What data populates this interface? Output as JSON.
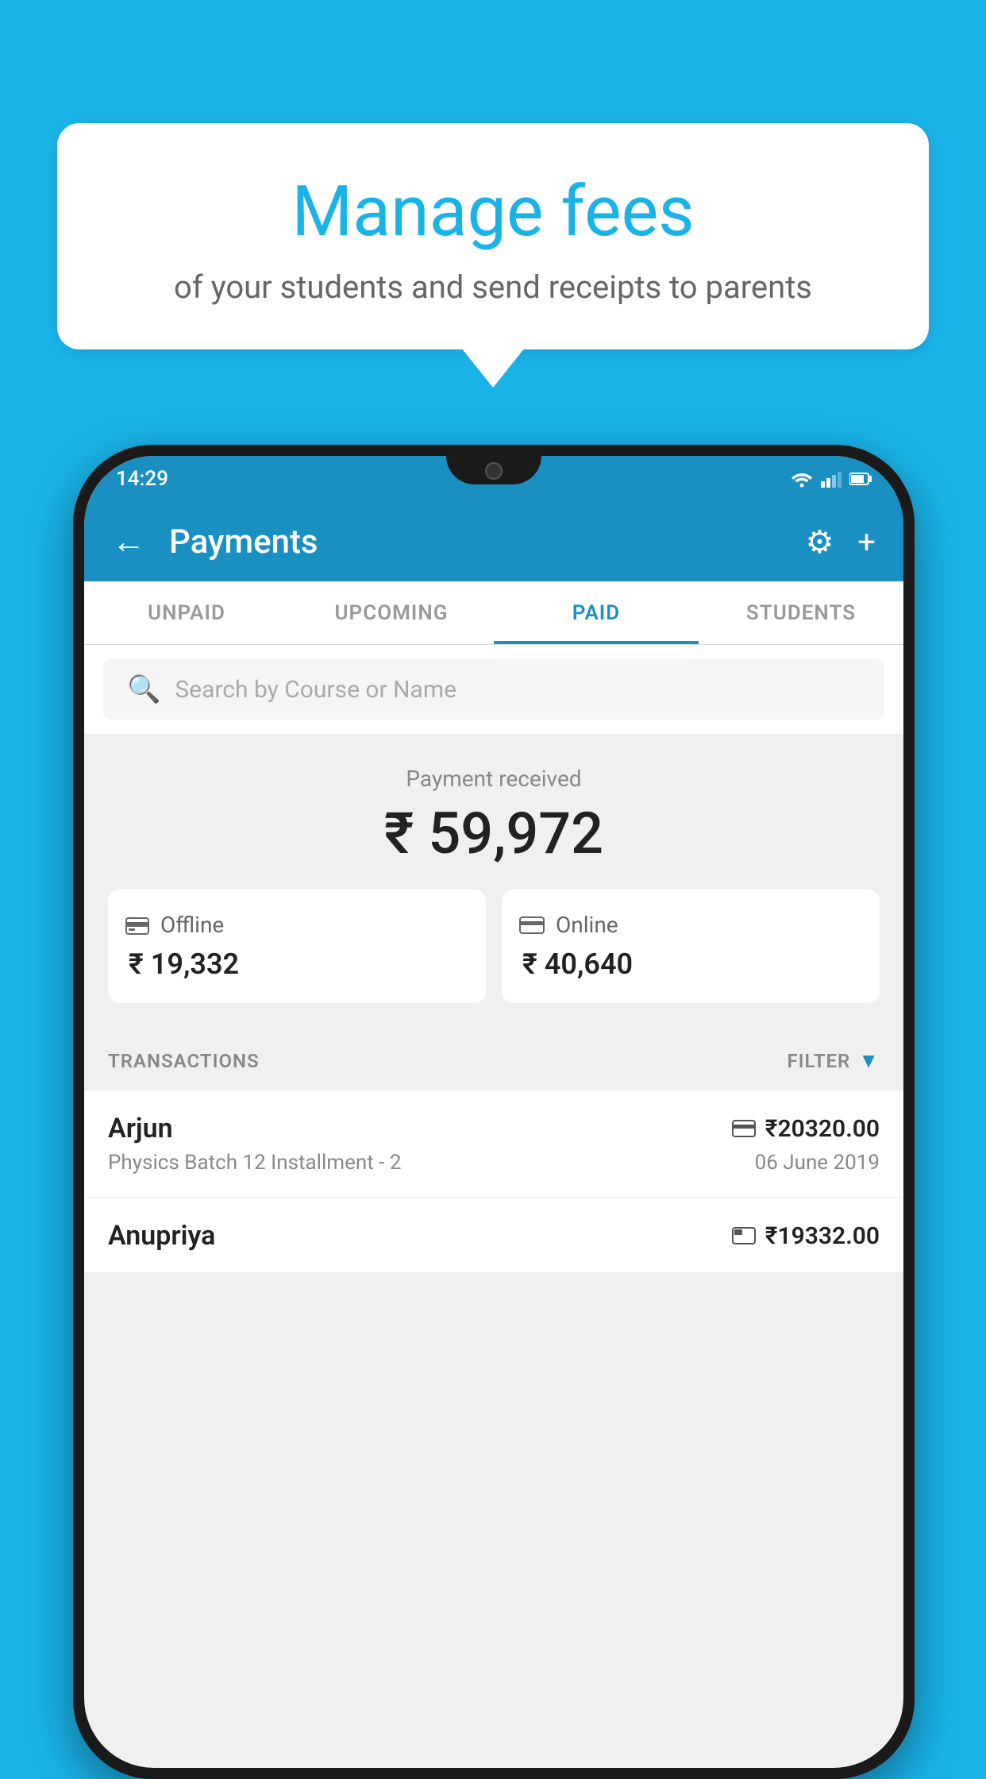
{
  "background_color": "#1ab3e8",
  "bubble": {
    "title": "Manage fees",
    "subtitle": "of your students and send receipts to parents"
  },
  "status_bar": {
    "time": "14:29"
  },
  "app_bar": {
    "title": "Payments",
    "back_label": "←",
    "gear_label": "⚙",
    "plus_label": "+"
  },
  "tabs": [
    {
      "label": "UNPAID",
      "active": false
    },
    {
      "label": "UPCOMING",
      "active": false
    },
    {
      "label": "PAID",
      "active": true
    },
    {
      "label": "STUDENTS",
      "active": false
    }
  ],
  "search": {
    "placeholder": "Search by Course or Name"
  },
  "payment_summary": {
    "label": "Payment received",
    "amount": "₹ 59,972",
    "offline": {
      "label": "Offline",
      "amount": "₹ 19,332"
    },
    "online": {
      "label": "Online",
      "amount": "₹ 40,640"
    }
  },
  "transactions_header": {
    "label": "TRANSACTIONS",
    "filter_label": "FILTER"
  },
  "transactions": [
    {
      "name": "Arjun",
      "course": "Physics Batch 12 Installment - 2",
      "amount": "₹20320.00",
      "date": "06 June 2019",
      "payment_type": "card"
    },
    {
      "name": "Anupriya",
      "course": "",
      "amount": "₹19332.00",
      "date": "",
      "payment_type": "offline"
    }
  ]
}
